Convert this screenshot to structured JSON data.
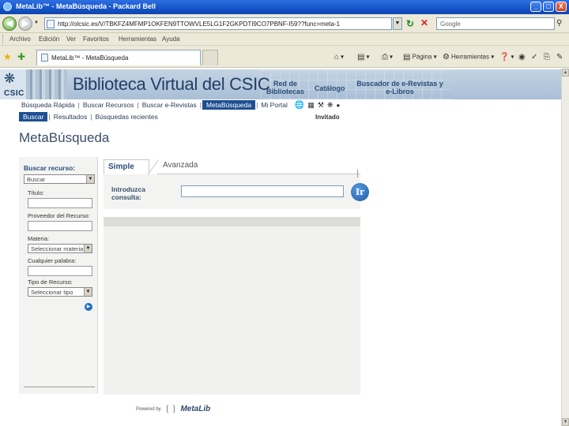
{
  "window": {
    "title": "MetaLib™ - MetaBúsqueda - Packard Bell",
    "buttons": [
      "_",
      "□",
      "X"
    ]
  },
  "address": {
    "url": "http://olcsic.es/V/TBKFZ4MFMP1OKFEN9TTOWVLE5LG1F2GKPDTI9CO7PBNF-I59??func=meta-1",
    "search_placeholder": "Google"
  },
  "menu": {
    "items": [
      "Archivo",
      "Edición",
      "Ver",
      "Favoritos",
      "Herramientas",
      "Ayuda"
    ]
  },
  "tabs": {
    "active": "MetaLib™ - MetaBúsqueda"
  },
  "toolbar": {
    "page": "Página",
    "tools": "Herramientas",
    "home_icon": "home-icon",
    "rss_icon": "feed-icon",
    "print_icon": "print-icon",
    "help_icon": "help-icon"
  },
  "banner": {
    "logo": "CSIC",
    "title": "Biblioteca Virtual del CSIC",
    "link1": "Red de Bibliotecas",
    "link2": "Catálogo",
    "link3": "Buscador de e-Revistas y e-Libros"
  },
  "main_tabs": [
    "Búsqueda Rápida",
    "Buscar Recursos",
    "Buscar e-Revistas",
    "MetaBúsqueda",
    "Mi Portal"
  ],
  "active_main_tab": "MetaBúsqueda",
  "sub_tabs": [
    "Buscar",
    "Resultados",
    "Búsquedas recientes"
  ],
  "guest": "Invitado",
  "page_heading": "MetaBúsqueda",
  "left_panel": {
    "heading": "Buscar recurso:",
    "mode": "Buscar",
    "title_label": "Título:",
    "provider_label": "Proveedor del Recurso:",
    "subject_label": "Materia:",
    "subject_value": "Seleccionar materia",
    "any_word_label": "Cualquier palabra:",
    "type_label": "Tipo de Recurso:",
    "type_value": "Seleccionar tipo"
  },
  "search": {
    "tab_simple": "Simple",
    "tab_advanced": "Avanzada",
    "query_label_1": "Introduzca",
    "query_label_2": "consulta:",
    "go": "Ir"
  },
  "footer": {
    "powered": "Powered by",
    "brand": "MetaLib"
  },
  "colors": {
    "title_bar": "#1453c8",
    "active_tab": "#1d4f91",
    "banner": "#a9bfd6",
    "heading": "#3c4e66"
  }
}
